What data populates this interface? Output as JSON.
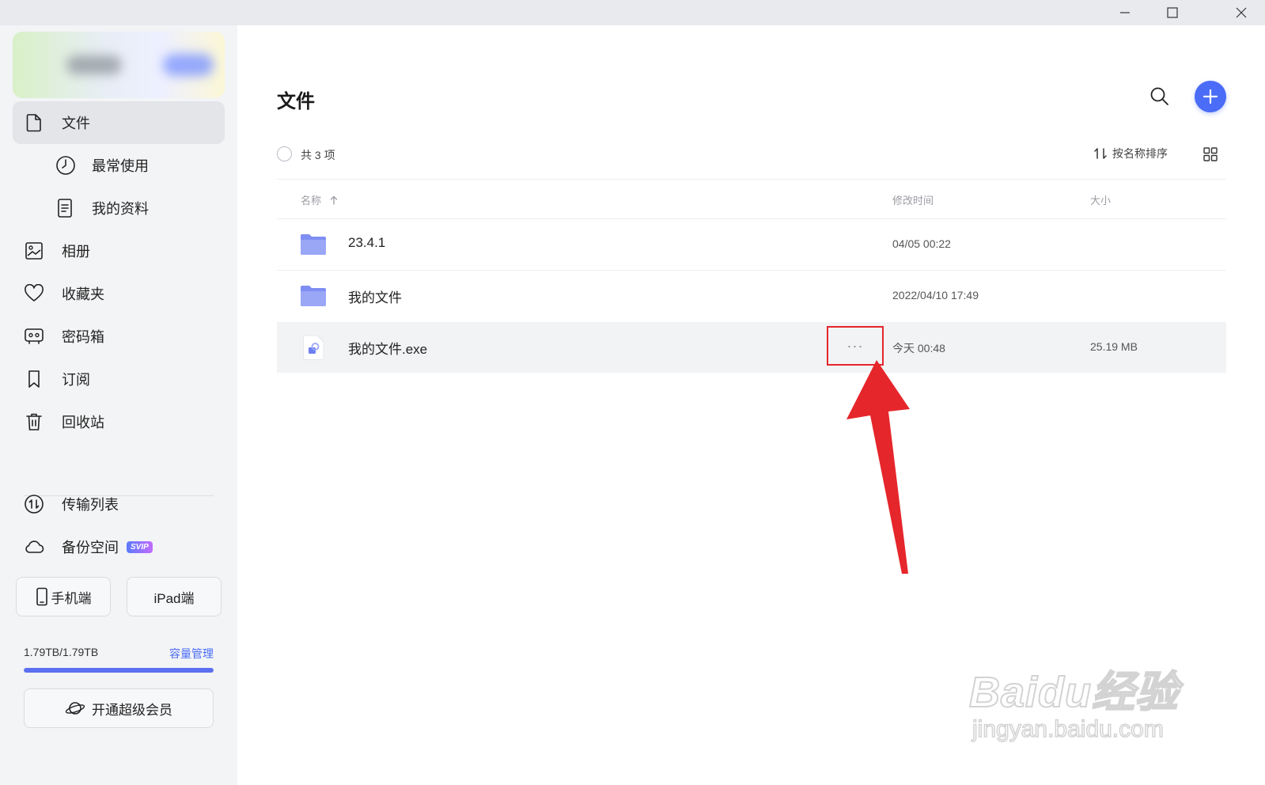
{
  "sidebar": {
    "items": [
      {
        "label": "文件"
      },
      {
        "label": "最常使用"
      },
      {
        "label": "我的资料"
      },
      {
        "label": "相册"
      },
      {
        "label": "收藏夹"
      },
      {
        "label": "密码箱"
      },
      {
        "label": "订阅"
      },
      {
        "label": "回收站"
      },
      {
        "label": "传输列表"
      },
      {
        "label": "备份空间",
        "badge": "SVIP"
      }
    ],
    "device_buttons": {
      "phone": "手机端",
      "ipad": "iPad端"
    },
    "storage": {
      "used_text": "1.79TB/1.79TB",
      "manage_label": "容量管理",
      "used_fraction": 1.0
    },
    "vip_label": "开通超级会员"
  },
  "main": {
    "title": "文件",
    "count_label": "共 3 项",
    "sort_label": "按名称排序",
    "columns": {
      "name": "名称",
      "modified": "修改时间",
      "size": "大小"
    },
    "files": [
      {
        "name": "23.4.1",
        "modified": "04/05 00:22",
        "size": "",
        "type": "folder"
      },
      {
        "name": "我的文件",
        "modified": "2022/04/10 17:49",
        "size": "",
        "type": "folder"
      },
      {
        "name": "我的文件.exe",
        "modified": "今天 00:48",
        "size": "25.19 MB",
        "type": "exe"
      }
    ],
    "more_label": "···"
  },
  "watermark": {
    "logo": "Baidu经验",
    "url": "jingyan.baidu.com"
  },
  "colors": {
    "accent": "#4a6cf7",
    "highlight": "#e5262b",
    "sidebar_bg": "#f3f4f6"
  }
}
